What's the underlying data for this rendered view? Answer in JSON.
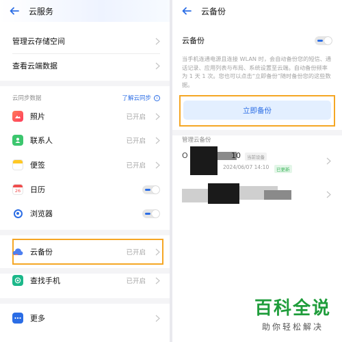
{
  "left": {
    "title": "云服务",
    "top_items": [
      {
        "label": "管理云存储空间"
      },
      {
        "label": "查看云端数据"
      }
    ],
    "section_label": "云同步数据",
    "learn_link": "了解云同步",
    "sync_items": [
      {
        "label": "照片",
        "status": "已开启",
        "icon": "photos-icon"
      },
      {
        "label": "联系人",
        "status": "已开启",
        "icon": "contacts-icon"
      },
      {
        "label": "便签",
        "status": "已开启",
        "icon": "notes-icon"
      },
      {
        "label": "日历",
        "icon": "calendar-icon",
        "calendar_day": "26",
        "toggle": true
      },
      {
        "label": "浏览器",
        "icon": "browser-icon",
        "toggle": true
      }
    ],
    "cloud_backup": {
      "label": "云备份",
      "status": "已开启"
    },
    "find_phone": {
      "label": "查找手机",
      "status": "已开启"
    },
    "more": {
      "label": "更多"
    }
  },
  "right": {
    "title": "云备份",
    "toggle_label": "云备份",
    "description": "当手机连通电源且连接 WLAN 时，会自动备份您的短信、通话记录、应用列表与布局、系统设置至云端。自动备份频率为 1 天 1 次。您也可以点击“立即备份”随时备份您的这些数据。",
    "backup_button": "立即备份",
    "manage_label": "管理云备份",
    "device1": {
      "name_suffix": "10",
      "tag": "当前设备",
      "time": "2024/06/07 14:10",
      "status_tag": "已更新"
    }
  },
  "watermark": {
    "main": "百科全说",
    "sub": "助你轻松解决"
  },
  "colors": {
    "accent": "#2b6de5",
    "highlight": "#f5a623",
    "watermark": "#1f9d3b"
  }
}
